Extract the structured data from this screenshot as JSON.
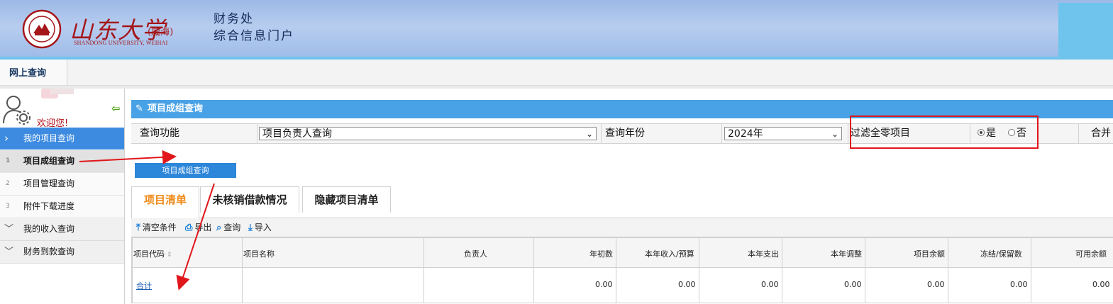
{
  "header": {
    "logo_cn": "山东大学",
    "logo_sub": "(威海)",
    "logo_en": "SHANDONG UNIVERSITY, WEIHAI",
    "dept_line1": "财务处",
    "dept_line2": "综合信息门户",
    "colors": {
      "banner": "#9db9e6",
      "accent_bar": "#6ec4ec",
      "logo_red": "#a4161a"
    }
  },
  "nav": {
    "tab_label": "网上查询"
  },
  "sidebar": {
    "welcome": "欢迎您!",
    "items": [
      {
        "label": "我的项目查询",
        "type": "group-active"
      },
      {
        "num": "1",
        "label": "项目成组查询",
        "type": "sub-selected"
      },
      {
        "num": "2",
        "label": "项目管理查询",
        "type": "sub"
      },
      {
        "num": "3",
        "label": "附件下载进度",
        "type": "sub"
      },
      {
        "label": "我的收入查询",
        "type": "group"
      },
      {
        "label": "财务到款查询",
        "type": "group"
      }
    ]
  },
  "panel": {
    "title": "项目成组查询",
    "form": {
      "func_label": "查询功能",
      "func_value": "项目负责人查询",
      "year_label": "查询年份",
      "year_value": "2024年",
      "filter_label": "过滤全零项目",
      "radio_yes": "是",
      "radio_no": "否",
      "radio_selected": "是",
      "merge_label": "合并"
    },
    "query_button": "项目成组查询",
    "tabs": [
      "项目清单",
      "未核销借款情况",
      "隐藏项目清单"
    ],
    "active_tab": "项目清单",
    "toolbar": {
      "clear": "清空条件",
      "export": "导出",
      "query": "查询",
      "import": "导入"
    },
    "table": {
      "headers": [
        "项目代码",
        "项目名称",
        "负责人",
        "年初数",
        "本年收入/预算",
        "本年支出",
        "本年调整",
        "项目余额",
        "冻结/保留数",
        "可用余额"
      ],
      "rows": [
        {
          "code": "合计",
          "name": "",
          "owner": "",
          "values": [
            "0.00",
            "0.00",
            "0.00",
            "0.00",
            "0.00",
            "0.00",
            "0.00"
          ]
        }
      ]
    }
  },
  "colors": {
    "primary": "#3d8be0",
    "title_bar": "#4aa2e6",
    "tab_active": "#f08a17",
    "annotation": "#e0161b"
  }
}
